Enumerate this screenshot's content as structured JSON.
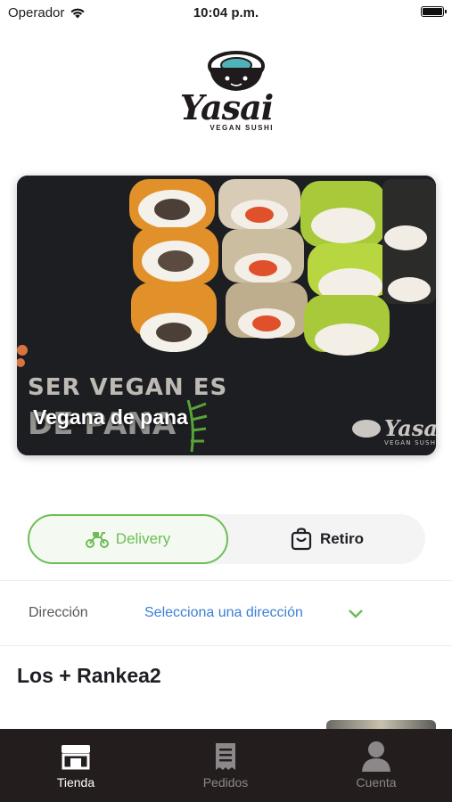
{
  "status_bar": {
    "carrier": "Operador",
    "time": "10:04 p.m.",
    "battery_level": 1.0
  },
  "brand": {
    "name": "Yasai",
    "tagline": "VEGAN SUSHI"
  },
  "banner": {
    "title": "Vegana de pana",
    "image_text_line1": "SER VEGAN ES",
    "image_text_line2": "DE PANA",
    "watermark_brand": "Yasai",
    "watermark_tag": "VEGAN SUSHI"
  },
  "order_type": {
    "delivery_label": "Delivery",
    "pickup_label": "Retiro",
    "selected": "delivery"
  },
  "address": {
    "label": "Dirección",
    "value": "Selecciona una dirección"
  },
  "section": {
    "title": "Los + Rankea2"
  },
  "tabbar": {
    "items": [
      {
        "label": "Tienda",
        "icon": "store-icon",
        "active": true
      },
      {
        "label": "Pedidos",
        "icon": "receipt-icon",
        "active": false
      },
      {
        "label": "Cuenta",
        "icon": "user-icon",
        "active": false
      }
    ]
  },
  "colors": {
    "accent_green": "#6dbd57",
    "link_blue": "#3a7fd6",
    "tabbar_bg": "#231d1e"
  }
}
